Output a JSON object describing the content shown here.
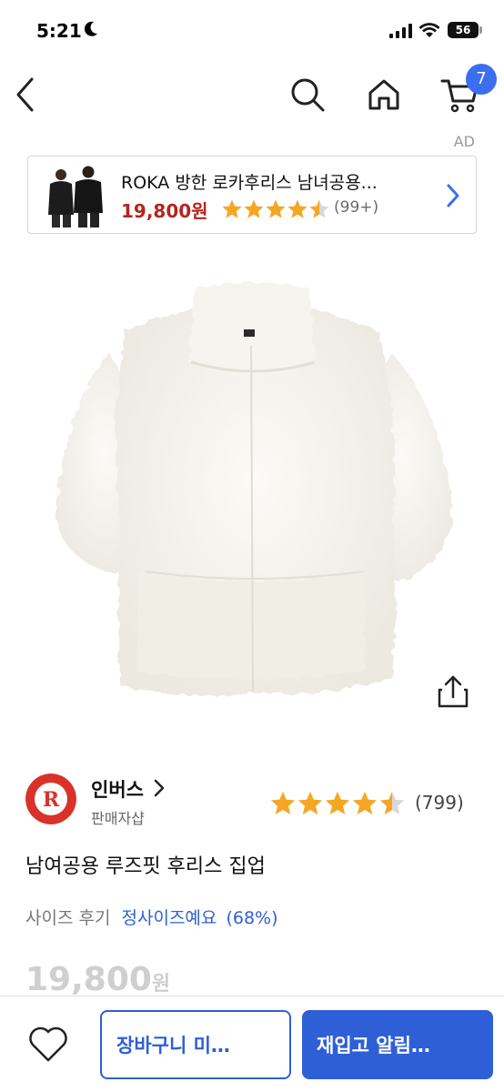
{
  "status_bar": {
    "time": "5:21",
    "battery": "56"
  },
  "nav": {
    "cart_count": "7"
  },
  "ad": {
    "label": "AD",
    "title": "ROKA 방한 로카후리스 남녀공용...",
    "price": "19,800원",
    "rating": 4.5,
    "review_count": "(99+)"
  },
  "seller": {
    "name": "인버스",
    "tag": "판매자샵",
    "rating": 4.5,
    "review_count": "(799)"
  },
  "product": {
    "title": "남여공용 루즈핏 후리스 집업",
    "size_review_label": "사이즈 후기",
    "size_review_value": "정사이즈예요",
    "size_review_pct": "(68%)",
    "price_number": "19,800",
    "price_unit": "원"
  },
  "bottom_bar": {
    "cart_button_label": "장바구니 미…",
    "notify_button_label": "재입고 알림…"
  },
  "colors": {
    "accent": "#2f5fd6",
    "badge": "#3b6ef0",
    "ad_price": "#b3261e",
    "star": "#f5a623"
  },
  "icons": [
    "back-icon",
    "search-icon",
    "home-icon",
    "cart-icon",
    "chevron-right-icon",
    "share-icon",
    "heart-icon",
    "star-icon"
  ]
}
